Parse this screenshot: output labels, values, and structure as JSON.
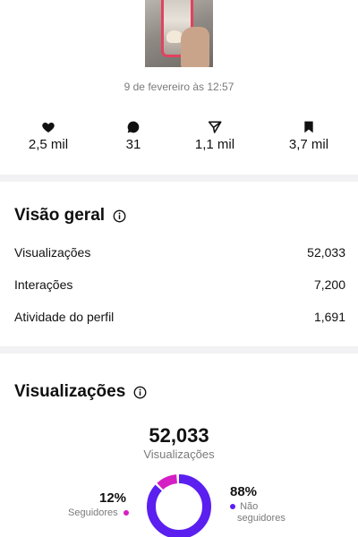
{
  "post": {
    "date": "9 de fevereiro às 12:57"
  },
  "stats": {
    "likes": "2,5 mil",
    "comments": "31",
    "shares": "1,1 mil",
    "saves": "3,7 mil"
  },
  "overview": {
    "title": "Visão geral",
    "rows": [
      {
        "label": "Visualizações",
        "value": "52,033"
      },
      {
        "label": "Interações",
        "value": "7,200"
      },
      {
        "label": "Atividade do perfil",
        "value": "1,691"
      }
    ]
  },
  "views": {
    "title": "Visualizações",
    "total": "52,033",
    "total_label": "Visualizações",
    "followers_pct": "12%",
    "followers_label": "Seguidores",
    "non_followers_pct": "88%",
    "non_followers_label_line1": "Não",
    "non_followers_label_line2": "seguidores",
    "followers_share": 0.12,
    "non_followers_share": 0.88,
    "colors": {
      "followers": "#d51fc4",
      "non_followers": "#5b1ff0"
    }
  }
}
